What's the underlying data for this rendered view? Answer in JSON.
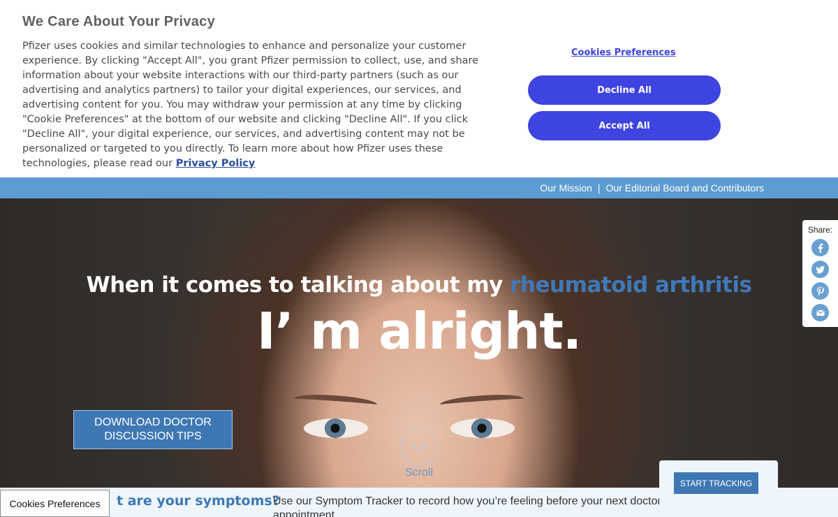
{
  "cookie_banner": {
    "title": "We Care About Your Privacy",
    "body": "Pfizer uses cookies and similar technologies to enhance and personalize your customer experience. By clicking \"Accept All\", you grant Pfizer permission to collect, use, and share information about your website interactions with our third-party partners (such as our advertising and analytics partners) to tailor your digital experiences, our services, and advertising content for you. You may withdraw your permission at any time by clicking \"Cookie Preferences\" at the bottom of our website and clicking \"Decline All\". If you click \"Decline All\", your digital experience, our services, and advertising content may not be personalized or targeted to you directly. To learn more about how Pfizer uses these technologies, please read our ",
    "privacy_link": "Privacy Policy",
    "preferences_link": "Cookies Preferences",
    "decline_label": "Decline All",
    "accept_label": "Accept All",
    "accent_color": "#3d44e0"
  },
  "nav": {
    "mission": "Our Mission",
    "separator": "|",
    "editorial": "Our Editorial Board and Contributors"
  },
  "hero": {
    "line1_prefix": "When it comes to talking about my ",
    "line1_accent": "rheumatoid arthritis",
    "line2": "I’   m alright."
  },
  "share": {
    "label": "Share:",
    "icons": [
      "facebook-icon",
      "twitter-icon",
      "pinterest-icon",
      "email-icon"
    ]
  },
  "download_button": "DOWNLOAD DOCTOR DISCUSSION TIPS",
  "scroll_label": "Scroll",
  "symptom": {
    "question": "t are your symptoms?",
    "description": "Use our Symptom Tracker to record how you’re feeling before your next doctor’s appointment",
    "tracker_button": "START TRACKING"
  },
  "cookie_footer_button": "Cookies Preferences"
}
